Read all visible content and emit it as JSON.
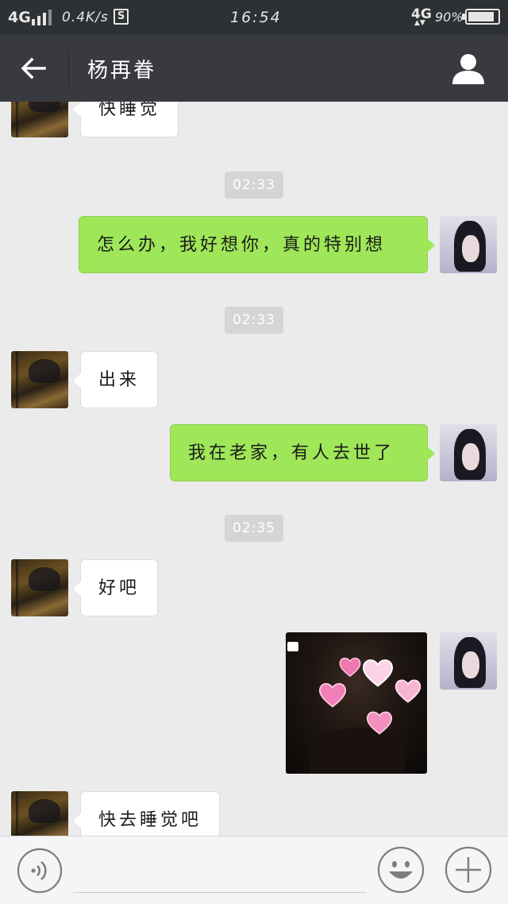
{
  "status_bar": {
    "network": "4G",
    "speed": "0.4K/s",
    "app_badge": "S",
    "time": "16:54",
    "network_right": "4G",
    "data_arrows": "▲▼",
    "battery_percent": "90%",
    "battery_level": 0.9
  },
  "header": {
    "contact_name": "杨再眷",
    "back_icon": "back-arrow-icon",
    "profile_icon": "person-icon"
  },
  "messages": [
    {
      "type": "text",
      "from": "contact",
      "text": "快睡觉"
    },
    {
      "type": "timestamp",
      "text": "02:33"
    },
    {
      "type": "text",
      "from": "me",
      "text": "怎么办，我好想你，真的特别想"
    },
    {
      "type": "timestamp",
      "text": "02:33"
    },
    {
      "type": "text",
      "from": "contact",
      "text": "出来"
    },
    {
      "type": "text",
      "from": "me",
      "text": "我在老家，有人去世了"
    },
    {
      "type": "timestamp",
      "text": "02:35"
    },
    {
      "type": "text",
      "from": "contact",
      "text": "好吧"
    },
    {
      "type": "image",
      "from": "me",
      "description_icon": "photo-with-heart-stickers"
    },
    {
      "type": "text",
      "from": "contact",
      "text": "快去睡觉吧"
    }
  ],
  "input_bar": {
    "voice_icon": "voice-icon",
    "emoji_icon": "emoji-icon",
    "more_icon": "plus-icon"
  },
  "colors": {
    "statusbar_bg": "#2e3133",
    "titlebar_bg": "#393a3f",
    "chat_bg": "#ebebeb",
    "outgoing_bubble": "#9fe658",
    "incoming_bubble": "#ffffff",
    "timestamp_bg": "#d5d5d5"
  }
}
